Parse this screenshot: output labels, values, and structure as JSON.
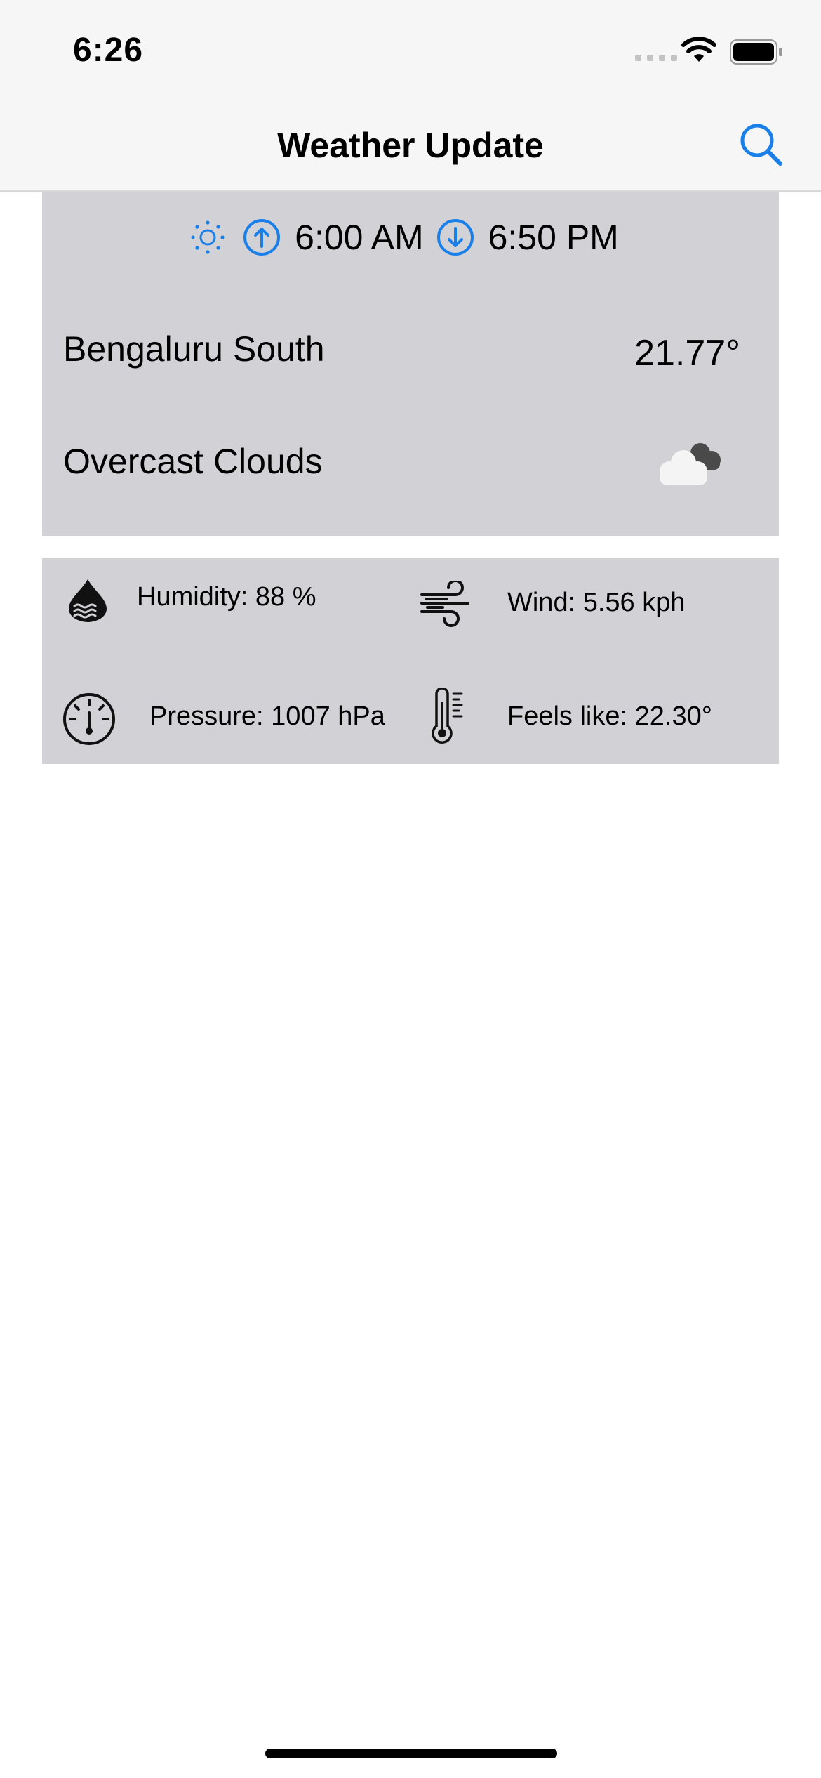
{
  "status_bar": {
    "time": "6:26"
  },
  "nav": {
    "title": "Weather Update",
    "search_icon": "magnifying-glass-icon"
  },
  "sun": {
    "sunrise": "6:00 AM",
    "sunset": "6:50 PM"
  },
  "weather": {
    "city": "Bengaluru South",
    "temperature": "21.77°",
    "description": "Overcast Clouds",
    "condition_icon": "cloud-icon"
  },
  "details": {
    "humidity": "Humidity: 88 %",
    "wind": "Wind: 5.56 kph",
    "pressure": "Pressure: 1007 hPa",
    "feels_like": "Feels like: 22.30°"
  },
  "colors": {
    "accent": "#1a7fe8",
    "card": "#d2d2d6",
    "nav_bg": "#f6f6f6"
  }
}
